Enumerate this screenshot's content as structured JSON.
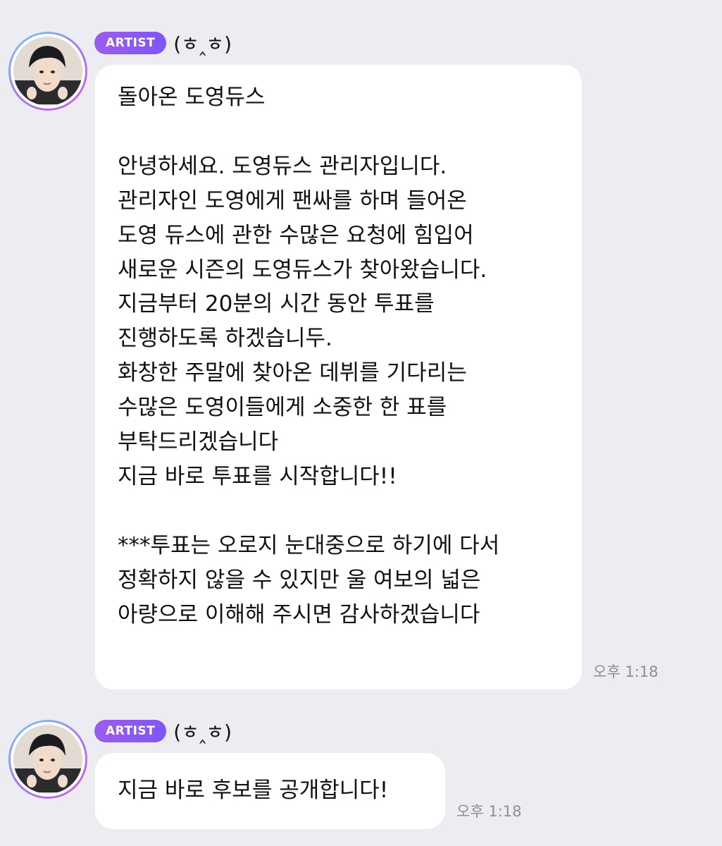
{
  "messages": [
    {
      "badge": "ARTIST",
      "nickname": "(ㅎ‸ㅎ)",
      "text": "돌아온 도영듀스\n\n안녕하세요. 도영듀스 관리자입니다.\n관리자인 도영에게 팬싸를 하며 들어온\n도영 듀스에 관한 수많은 요청에 힘입어\n새로운 시즌의 도영듀스가 찾아왔습니다.\n지금부터 20분의 시간 동안 투표를\n진행하도록 하겠습니두.\n화창한 주말에 찾아온 데뷔를 기다리는\n수많은 도영이들에게 소중한 한 표를\n부탁드리겠습니다\n지금 바로 투표를 시작합니다!!\n\n***투표는 오로지 눈대중으로 하기에 다서\n정확하지 않을 수 있지만 울 여보의 넓은\n아량으로 이해해 주시면 감사하겠습니다",
      "time": "오후 1:18"
    },
    {
      "badge": "ARTIST",
      "nickname": "(ㅎ‸ㅎ)",
      "text": "지금 바로 후보를 공개합니다!",
      "time": "오후 1:18"
    }
  ],
  "colors": {
    "background": "#ececf1",
    "bubble": "#ffffff",
    "badge_start": "#9b5cf0",
    "badge_end": "#7f57f4",
    "avatar_ring": "#a07cf0",
    "time": "#8f8f8f"
  }
}
